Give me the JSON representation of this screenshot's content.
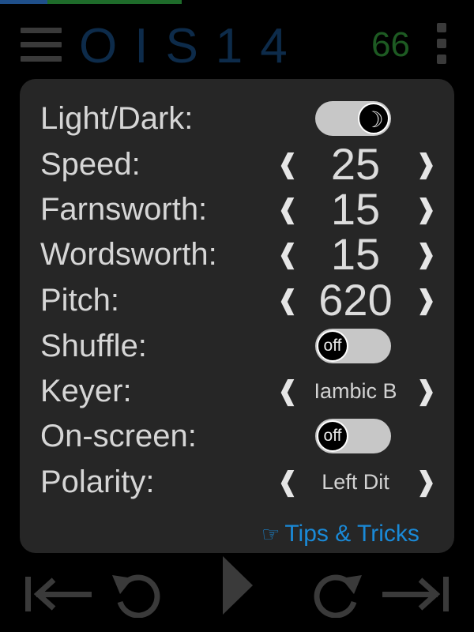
{
  "progress": {
    "played_fraction": 0.383,
    "colors": {
      "segment_a": "#1f4f8a",
      "segment_b": "#1e6b2a"
    }
  },
  "header": {
    "title": "OIS14",
    "counter": "66",
    "menu_icon": "hamburger-menu-icon",
    "overflow_icon": "vertical-ellipsis-icon"
  },
  "settings": {
    "light_dark": {
      "label": "Light/Dark:",
      "state": "dark",
      "icon": "moon-icon",
      "glyph": "☽"
    },
    "speed": {
      "label": "Speed:",
      "value": "25"
    },
    "farnsworth": {
      "label": "Farnsworth:",
      "value": "15"
    },
    "wordsworth": {
      "label": "Wordsworth:",
      "value": "15"
    },
    "pitch": {
      "label": "Pitch:",
      "value": "620"
    },
    "shuffle": {
      "label": "Shuffle:",
      "state": "off"
    },
    "keyer": {
      "label": "Keyer:",
      "value": "Iambic B"
    },
    "onscreen": {
      "label": "On-screen:",
      "state": "off"
    },
    "polarity": {
      "label": "Polarity:",
      "value": "Left Dit"
    },
    "arrows": {
      "left": "❰",
      "right": "❱"
    }
  },
  "tips": {
    "icon": "pointing-hand-icon",
    "hand": "☞",
    "label": "Tips & Tricks"
  },
  "controls": {
    "icons": [
      "skip-to-start-icon",
      "rewind-icon",
      "play-icon",
      "forward-icon",
      "skip-to-end-icon"
    ]
  },
  "colors": {
    "panel": "#262626",
    "accent_link": "#1a8ad8",
    "title": "#0d2b4a",
    "counter": "#1d5a22"
  }
}
